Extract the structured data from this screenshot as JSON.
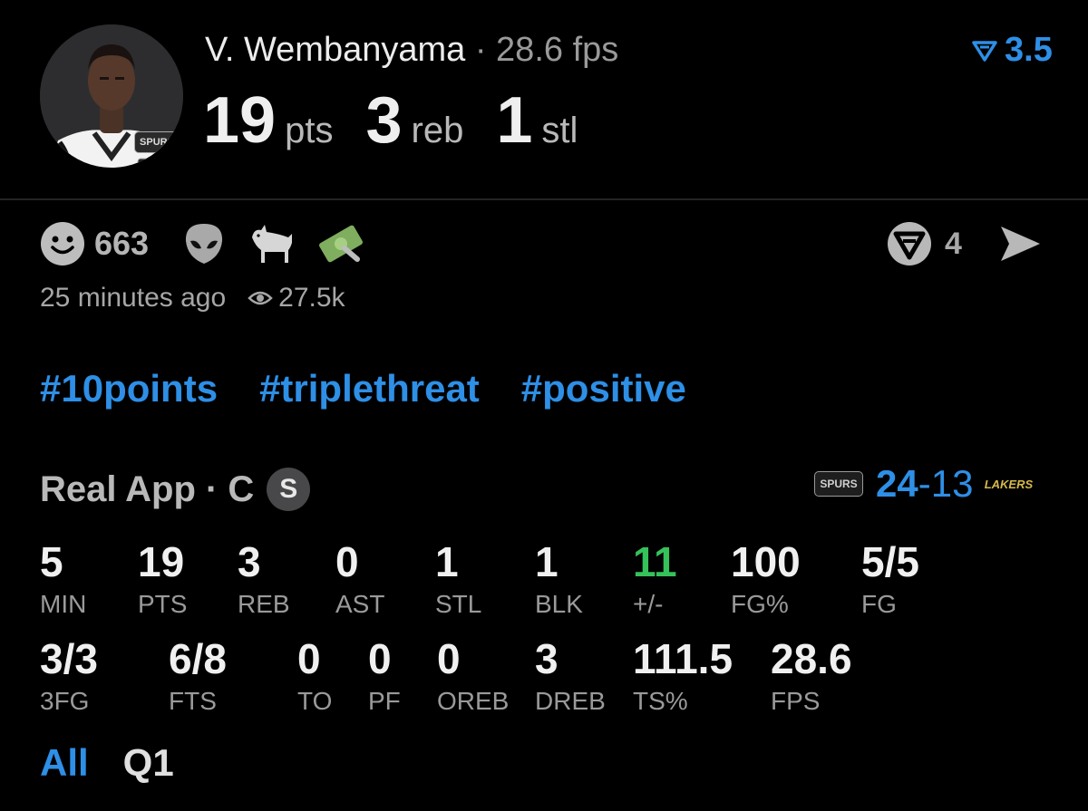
{
  "player": {
    "name": "V. Wembanyama",
    "separator": "·",
    "fps": "28.6 fps",
    "avatar_team": "SPURS",
    "big_stats": [
      {
        "value": "19",
        "label": "pts"
      },
      {
        "value": "3",
        "label": "reb"
      },
      {
        "value": "1",
        "label": "stl"
      }
    ]
  },
  "line": {
    "value": "3.5",
    "icon": "real-logo-icon",
    "color": "#2e8fe6"
  },
  "reactions": {
    "count": "663",
    "icons": [
      "smiley-icon",
      "alien-icon",
      "goat-icon",
      "money-icon"
    ]
  },
  "meta": {
    "time": "25 minutes ago",
    "views": "27.5k"
  },
  "share": {
    "count": "4"
  },
  "hashtags": [
    "#10points",
    "#triplethreat",
    "#positive"
  ],
  "source": {
    "text": "Real App · C",
    "badge": "S"
  },
  "score": {
    "home": "24",
    "sep": "-",
    "away": "13",
    "home_team": "SPURS",
    "away_team": "LAKERS"
  },
  "stats_row1": [
    {
      "value": "5",
      "label": "MIN"
    },
    {
      "value": "19",
      "label": "PTS"
    },
    {
      "value": "3",
      "label": "REB"
    },
    {
      "value": "0",
      "label": "AST"
    },
    {
      "value": "1",
      "label": "STL"
    },
    {
      "value": "1",
      "label": "BLK"
    },
    {
      "value": "11",
      "label": "+/-"
    },
    {
      "value": "100",
      "label": "FG%"
    },
    {
      "value": "5/5",
      "label": "FG"
    }
  ],
  "stats_row2": [
    {
      "value": "3/3",
      "label": "3FG"
    },
    {
      "value": "6/8",
      "label": "FTS"
    },
    {
      "value": "0",
      "label": "TO"
    },
    {
      "value": "0",
      "label": "PF"
    },
    {
      "value": "0",
      "label": "OREB"
    },
    {
      "value": "3",
      "label": "DREB"
    },
    {
      "value": "111.5",
      "label": "TS%"
    },
    {
      "value": "28.6",
      "label": "FPS"
    }
  ],
  "tabs": [
    "All",
    "Q1"
  ],
  "colors": {
    "accent": "#2e8fe6",
    "positive": "#35c25a",
    "background": "#000000"
  }
}
